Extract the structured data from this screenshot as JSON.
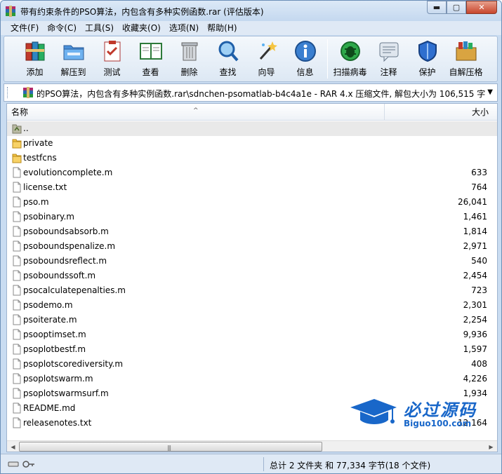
{
  "window": {
    "title": "带有约束条件的PSO算法，内包含有多种实例函数.rar (评估版本)",
    "buttons": {
      "minimize": "▬",
      "maximize": "▢",
      "close": "✕"
    }
  },
  "menubar": {
    "items": [
      {
        "label": "文件(F)"
      },
      {
        "label": "命令(C)"
      },
      {
        "label": "工具(S)"
      },
      {
        "label": "收藏夹(O)"
      },
      {
        "label": "选项(N)"
      },
      {
        "label": "帮助(H)"
      }
    ]
  },
  "toolbar": {
    "buttons": [
      {
        "label": "添加",
        "icon": "books-add-icon"
      },
      {
        "label": "解压到",
        "icon": "folder-extract-icon"
      },
      {
        "label": "测试",
        "icon": "clipboard-check-icon"
      },
      {
        "label": "查看",
        "icon": "open-book-icon"
      },
      {
        "label": "删除",
        "icon": "trash-can-icon"
      },
      {
        "label": "查找",
        "icon": "magnifier-icon"
      },
      {
        "label": "向导",
        "icon": "magic-wand-icon"
      },
      {
        "label": "信息",
        "icon": "info-icon"
      },
      {
        "label": "扫描病毒",
        "icon": "virus-scan-icon"
      },
      {
        "label": "注释",
        "icon": "comment-icon"
      },
      {
        "label": "保护",
        "icon": "shield-icon"
      },
      {
        "label": "自解压格",
        "icon": "sfx-box-icon"
      }
    ]
  },
  "addressbar": {
    "path": "的PSO算法，内包含有多种实例函数.rar\\sdnchen-psomatlab-b4c4a1e - RAR 4.x 压缩文件, 解包大小为 106,515 字节"
  },
  "filelist": {
    "columns": {
      "name": "名称",
      "size": "大小"
    },
    "rows": [
      {
        "name": "..",
        "size": "",
        "type": "up"
      },
      {
        "name": "private",
        "size": "",
        "type": "folder"
      },
      {
        "name": "testfcns",
        "size": "",
        "type": "folder"
      },
      {
        "name": "evolutioncomplete.m",
        "size": "633",
        "type": "file"
      },
      {
        "name": "license.txt",
        "size": "764",
        "type": "file"
      },
      {
        "name": "pso.m",
        "size": "26,041",
        "type": "file"
      },
      {
        "name": "psobinary.m",
        "size": "1,461",
        "type": "file"
      },
      {
        "name": "psoboundsabsorb.m",
        "size": "1,814",
        "type": "file"
      },
      {
        "name": "psoboundspenalize.m",
        "size": "2,971",
        "type": "file"
      },
      {
        "name": "psoboundsreflect.m",
        "size": "540",
        "type": "file"
      },
      {
        "name": "psoboundssoft.m",
        "size": "2,454",
        "type": "file"
      },
      {
        "name": "psocalculatepenalties.m",
        "size": "723",
        "type": "file"
      },
      {
        "name": "psodemo.m",
        "size": "2,301",
        "type": "file"
      },
      {
        "name": "psoiterate.m",
        "size": "2,254",
        "type": "file"
      },
      {
        "name": "psooptimset.m",
        "size": "9,936",
        "type": "file"
      },
      {
        "name": "psoplotbestf.m",
        "size": "1,597",
        "type": "file"
      },
      {
        "name": "psoplotscorediversity.m",
        "size": "408",
        "type": "file"
      },
      {
        "name": "psoplotswarm.m",
        "size": "4,226",
        "type": "file"
      },
      {
        "name": "psoplotswarmsurf.m",
        "size": "1,934",
        "type": "file"
      },
      {
        "name": "README.md",
        "size": "",
        "type": "file"
      },
      {
        "name": "releasenotes.txt",
        "size": "12,164",
        "type": "file"
      }
    ]
  },
  "statusbar": {
    "text": "总计 2 文件夹 和 77,334 字节(18 个文件)"
  },
  "watermark": {
    "title": "必过源码",
    "subtitle": "Biguo100.com"
  },
  "colors": {
    "accent": "#1967c9",
    "chrome": "#c9dcf1",
    "selection": "#e9e9e9"
  }
}
